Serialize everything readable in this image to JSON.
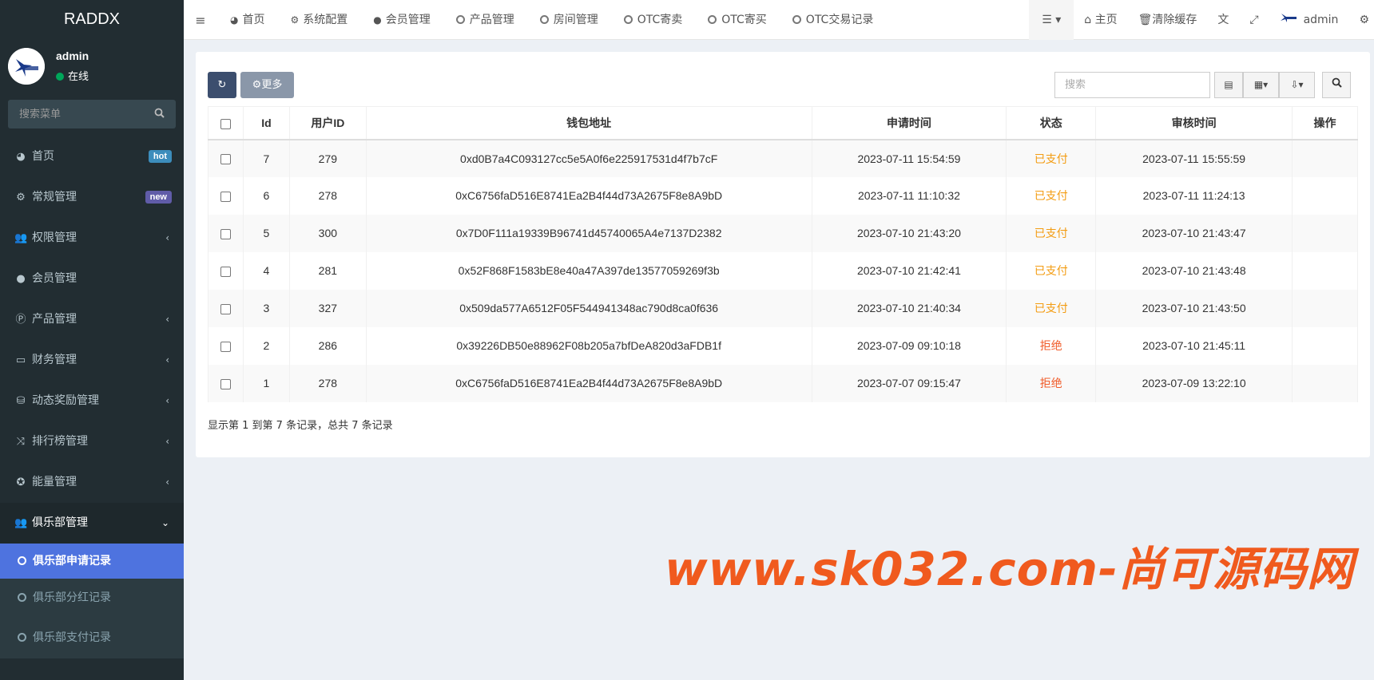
{
  "app": {
    "logo_text": "RADDX"
  },
  "user": {
    "name": "admin",
    "status": "在线"
  },
  "sidebar": {
    "search_placeholder": "搜索菜单",
    "items": [
      {
        "label": "首页",
        "icon": "dashboard-icon",
        "badge": "hot",
        "badge_color": "#3c8dbc"
      },
      {
        "label": "常规管理",
        "icon": "cogs-icon",
        "badge": "new",
        "badge_color": "#605ca8"
      },
      {
        "label": "权限管理",
        "icon": "users-icon"
      },
      {
        "label": "会员管理",
        "icon": "user-icon"
      },
      {
        "label": "产品管理",
        "icon": "product-icon"
      },
      {
        "label": "财务管理",
        "icon": "credit-card-icon"
      },
      {
        "label": "动态奖励管理",
        "icon": "database-icon"
      },
      {
        "label": "排行榜管理",
        "icon": "random-icon"
      },
      {
        "label": "能量管理",
        "icon": "energy-icon"
      },
      {
        "label": "俱乐部管理",
        "icon": "users-icon"
      }
    ],
    "sub_items": [
      {
        "label": "俱乐部申请记录"
      },
      {
        "label": "俱乐部分红记录"
      },
      {
        "label": "俱乐部支付记录"
      }
    ]
  },
  "navbar": {
    "tabs": [
      {
        "label": "首页",
        "icon": "dashboard-icon"
      },
      {
        "label": "系统配置",
        "icon": "gear-icon"
      },
      {
        "label": "会员管理",
        "icon": "user-icon"
      },
      {
        "label": "产品管理",
        "icon": "circle-icon"
      },
      {
        "label": "房间管理",
        "icon": "circle-icon"
      },
      {
        "label": "OTC寄卖",
        "icon": "circle-icon"
      },
      {
        "label": "OTC寄买",
        "icon": "circle-icon"
      },
      {
        "label": "OTC交易记录",
        "icon": "circle-icon"
      }
    ],
    "home_label": "主页",
    "clear_cache_label": "清除缓存",
    "user_label": "admin"
  },
  "toolbar": {
    "more_label": "更多",
    "search_placeholder": "搜索"
  },
  "table": {
    "columns": [
      "Id",
      "用户ID",
      "钱包地址",
      "申请时间",
      "状态",
      "审核时间",
      "操作"
    ],
    "rows": [
      {
        "id": "7",
        "uid": "279",
        "wallet": "0xd0B7a4C093127cc5e5A0f6e225917531d4f7b7cF",
        "apply_time": "2023-07-11 15:54:59",
        "status": "已支付",
        "review_time": "2023-07-11 15:55:59"
      },
      {
        "id": "6",
        "uid": "278",
        "wallet": "0xC6756faD516E8741Ea2B4f44d73A2675F8e8A9bD",
        "apply_time": "2023-07-11 11:10:32",
        "status": "已支付",
        "review_time": "2023-07-11 11:24:13"
      },
      {
        "id": "5",
        "uid": "300",
        "wallet": "0x7D0F111a19339B96741d45740065A4e7137D2382",
        "apply_time": "2023-07-10 21:43:20",
        "status": "已支付",
        "review_time": "2023-07-10 21:43:47"
      },
      {
        "id": "4",
        "uid": "281",
        "wallet": "0x52F868F1583bE8e40a47A397de13577059269f3b",
        "apply_time": "2023-07-10 21:42:41",
        "status": "已支付",
        "review_time": "2023-07-10 21:43:48"
      },
      {
        "id": "3",
        "uid": "327",
        "wallet": "0x509da577A6512F05F544941348ac790d8ca0f636",
        "apply_time": "2023-07-10 21:40:34",
        "status": "已支付",
        "review_time": "2023-07-10 21:43:50"
      },
      {
        "id": "2",
        "uid": "286",
        "wallet": "0x39226DB50e88962F08b205a7bfDeA820d3aFDB1f",
        "apply_time": "2023-07-09 09:10:18",
        "status": "拒绝",
        "review_time": "2023-07-10 21:45:11"
      },
      {
        "id": "1",
        "uid": "278",
        "wallet": "0xC6756faD516E8741Ea2B4f44d73A2675F8e8A9bD",
        "apply_time": "2023-07-07 09:15:47",
        "status": "拒绝",
        "review_time": "2023-07-09 13:22:10"
      }
    ]
  },
  "pager": {
    "info": "显示第 1 到第 7 条记录，总共 7 条记录"
  },
  "watermark": {
    "text": "www.sk032.com-尚可源码网"
  },
  "colors": {
    "paid": "#f39c12",
    "rejected": "#f05a28",
    "active_menu": "#4e73df",
    "sidebar_bg": "#222d32"
  }
}
